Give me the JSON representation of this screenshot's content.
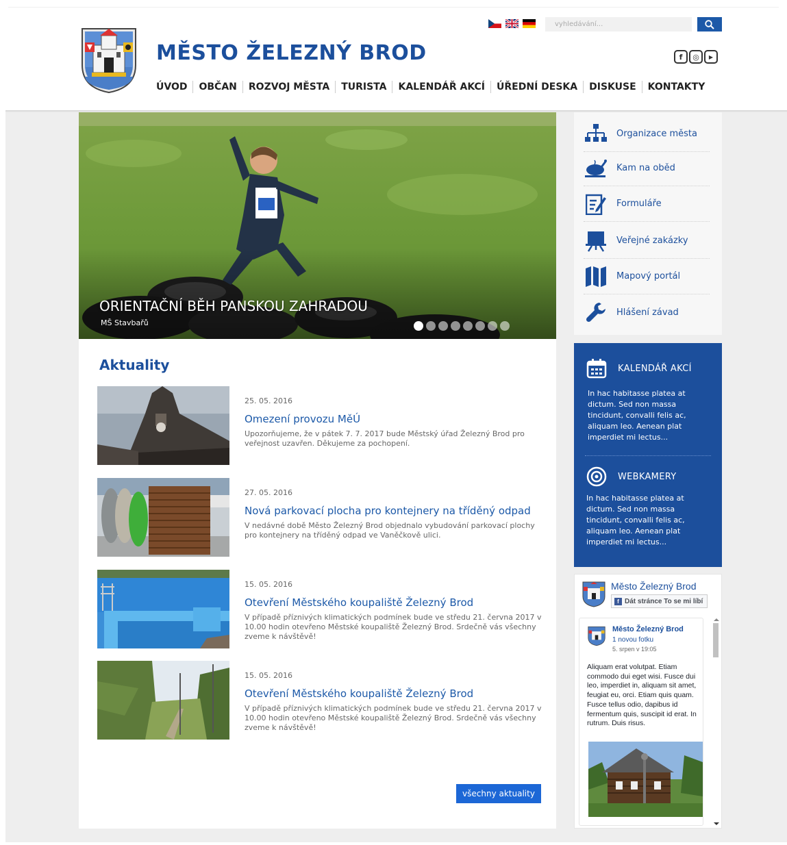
{
  "header": {
    "site_title": "MĚSTO ŽELEZNÝ BROD",
    "search": {
      "placeholder": "vyhledávání..."
    },
    "languages": [
      "cz-flag-icon",
      "uk-flag-icon",
      "de-flag-icon"
    ],
    "social": [
      {
        "icon": "facebook-icon",
        "glyph": "f"
      },
      {
        "icon": "instagram-icon",
        "glyph": "◎"
      },
      {
        "icon": "youtube-icon",
        "glyph": "▶"
      }
    ],
    "nav": [
      "ÚVOD",
      "OBČAN",
      "ROZVOJ MĚSTA",
      "TURISTA",
      "KALENDÁŘ AKCÍ",
      "ÚŘEDNÍ DESKA",
      "DISKUSE",
      "KONTAKTY"
    ]
  },
  "hero": {
    "title": "ORIENTAČNÍ BĚH PANSKOU ZAHRADOU",
    "subtitle": "MŠ Stavbařů",
    "slide_count": 8,
    "active_slide": 1
  },
  "news": {
    "heading": "Aktuality",
    "items": [
      {
        "date": "25. 05. 2016",
        "title": "Omezení provozu MěÚ",
        "text": "Upozorňujeme, že v pátek 7. 7. 2017 bude Městský úřad Železný Brod pro veřejnost uzavřen. Děkujeme za pochopení."
      },
      {
        "date": "27. 05. 2016",
        "title": "Nová parkovací plocha pro kontejnery na tříděný odpad",
        "text": "V nedávné době Město Železný Brod objednalo vybudování parkovací plochy pro kontejnery na tříděný odpad ve Vaněčkově ulici."
      },
      {
        "date": "15. 05. 2016",
        "title": "Otevření Městského koupaliště Železný Brod",
        "text": "V případě příznivých klimatických podmínek bude ve středu 21. června 2017 v 10.00 hodin otevřeno Městské koupaliště Železný Brod. Srdečně vás všechny zveme k návštěvě!"
      },
      {
        "date": "15. 05. 2016",
        "title": "Otevření Městského koupaliště Železný Brod",
        "text": "V případě příznivých klimatických podmínek bude ve středu 21. června 2017 v 10.00 hodin otevřeno Městské koupaliště Železný Brod. Srdečně vás všechny zveme k návštěvě!"
      }
    ],
    "all_label": "všechny aktuality"
  },
  "quick_links": [
    {
      "label": "Organizace města",
      "icon": "org-chart-icon"
    },
    {
      "label": "Kam na oběd",
      "icon": "roast-chicken-icon"
    },
    {
      "label": "Formuláře",
      "icon": "form-icon"
    },
    {
      "label": "Veřejné zakázky",
      "icon": "presentation-board-icon"
    },
    {
      "label": "Mapový portál",
      "icon": "map-icon"
    },
    {
      "label": "Hlášení závad",
      "icon": "wrench-icon"
    }
  ],
  "blue_box": {
    "calendar": {
      "title": "KALENDÁŘ AKCÍ",
      "text": "In hac habitasse platea at dictum. Sed non massa tincidunt, convalli felis ac, aliquam leo. Aenean plat imperdiet mi lectus..."
    },
    "webcams": {
      "title": "WEBKAMERY",
      "text": "In hac habitasse platea at dictum. Sed non massa tincidunt, convalli felis ac, aliquam leo. Aenean plat imperdiet mi lectus..."
    }
  },
  "facebook": {
    "page_name": "Město Železný Brod",
    "like_label": "Dát stránce To se mi líbí",
    "post": {
      "author": "Město Železný Brod",
      "action": "1 novou fotku",
      "time": "5. srpen v 19:05",
      "text": "Aliquam erat volutpat. Etiam commodo dui eget wisi. Fusce dui leo, imperdiet in, aliquam sit amet, feugiat eu, orci. Etiam quis quam. Fusce tellus odio, dapibus id fermentum quis, suscipit id erat. In rutrum. Duis risus."
    }
  },
  "colors": {
    "brand_blue": "#1c4f9c",
    "link_blue": "#1c59a8",
    "button_blue": "#1c67d6",
    "page_gray": "#eeeeee"
  }
}
